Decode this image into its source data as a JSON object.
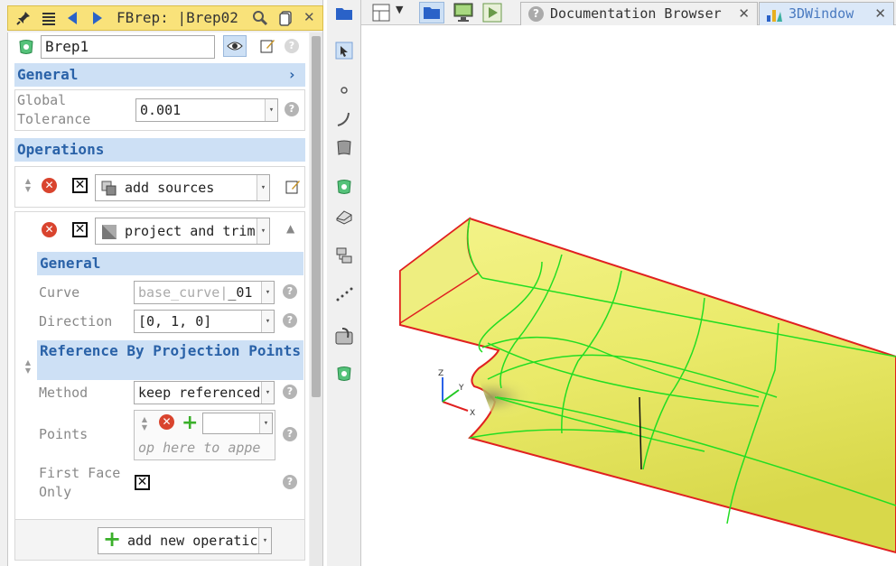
{
  "panel": {
    "title_prefix": "FBrep:",
    "title": "|Brep02",
    "object_name": "Brep1",
    "general": {
      "header": "General",
      "tolerance_label": "Global Tolerance",
      "tolerance_value": "0.001"
    },
    "operations": {
      "header": "Operations",
      "op1_label": "add sources",
      "op2_label": "project and trim",
      "sub_general_header": "General",
      "curve_label": "Curve",
      "curve_value_ph": "base_curve",
      "curve_value": "_01",
      "direction_label": "Direction",
      "direction_value": "[0, 1, 0]",
      "refproj_header": "Reference By Projection Points",
      "method_label": "Method",
      "method_value": "keep referenced",
      "points_label": "Points",
      "points_drop_text": "op here to appe",
      "firstface_label": "First Face Only",
      "add_op_label": "add new operatic"
    }
  },
  "tabs": [
    {
      "label": "Documentation Browser"
    },
    {
      "label": "3DWindow"
    }
  ],
  "axes": {
    "z": "Z",
    "y": "Y",
    "x": "X"
  },
  "help_glyph": "?",
  "x_glyph": "✕",
  "close_glyph": "✕",
  "colors": {
    "title_bar": "#f9e27a",
    "section_header": "#cde0f5",
    "section_text": "#2a62a8",
    "hull_fill": "#eded6a",
    "hull_edge": "#e02020",
    "hull_lines": "#22dd22",
    "active_tab": "#dbe8f8"
  }
}
